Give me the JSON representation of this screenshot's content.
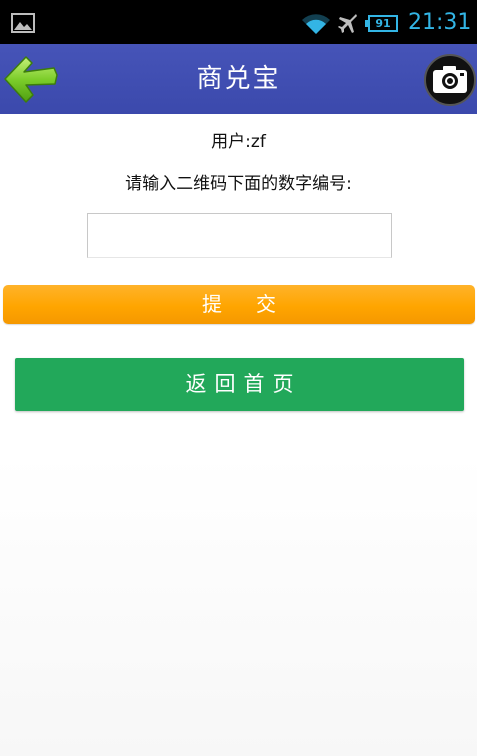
{
  "status_bar": {
    "battery_level": "91",
    "time": "21:31",
    "icons": [
      "gallery-icon",
      "wifi-icon",
      "airplane-icon",
      "battery-icon"
    ],
    "accent_color": "#33b5e5"
  },
  "title_bar": {
    "title": "商兑宝",
    "background_color": "#3f51b5",
    "back_icon": "green-left-arrow-icon",
    "camera_icon": "camera-icon"
  },
  "form": {
    "user_label": "用户:zf",
    "prompt": "请输入二维码下面的数字编号:",
    "code_input_value": "",
    "code_input_placeholder": "",
    "submit_label": "提交",
    "submit_color": "#ffa500"
  },
  "home_button": {
    "label": "返回首页",
    "color": "#22a85a"
  }
}
